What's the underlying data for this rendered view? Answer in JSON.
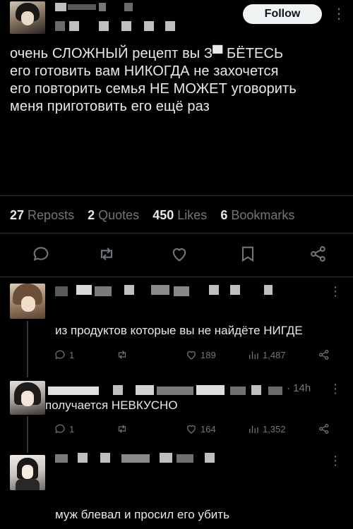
{
  "header": {
    "follow_label": "Follow",
    "more_label": "⋮"
  },
  "tweet": {
    "lines": [
      "очень СЛОЖНЫЙ рецепт вы З▀ БЁТЕСЬ",
      "его готовить вам НИКОГДА не захочется",
      "его повторить семья НЕ МОЖЕТ уговорить",
      "меня приготовить его ещё раз"
    ],
    "stats": {
      "reposts_count": "27",
      "reposts_label": "Reposts",
      "quotes_count": "2",
      "quotes_label": "Quotes",
      "likes_count": "450",
      "likes_label": "Likes",
      "bookmarks_count": "6",
      "bookmarks_label": "Bookmarks"
    },
    "action_icons": [
      "reply-icon",
      "retweet-icon",
      "like-icon",
      "bookmark-icon",
      "share-icon"
    ]
  },
  "replies": [
    {
      "text": "из продуктов которые вы не найдёте НИГДЕ",
      "reply_count": "1",
      "like_count": "189",
      "view_count": "1,487"
    },
    {
      "time": "· 14h",
      "text": "получается НЕВКУСНО",
      "reply_count": "1",
      "like_count": "164",
      "view_count": "1,352"
    },
    {
      "text": "муж блевал и просил его убить"
    }
  ],
  "colors": {
    "background": "#000000",
    "text": "#e7e9ea",
    "muted": "#71767b",
    "divider": "#2f3336",
    "follow_bg": "#eff3f4"
  }
}
